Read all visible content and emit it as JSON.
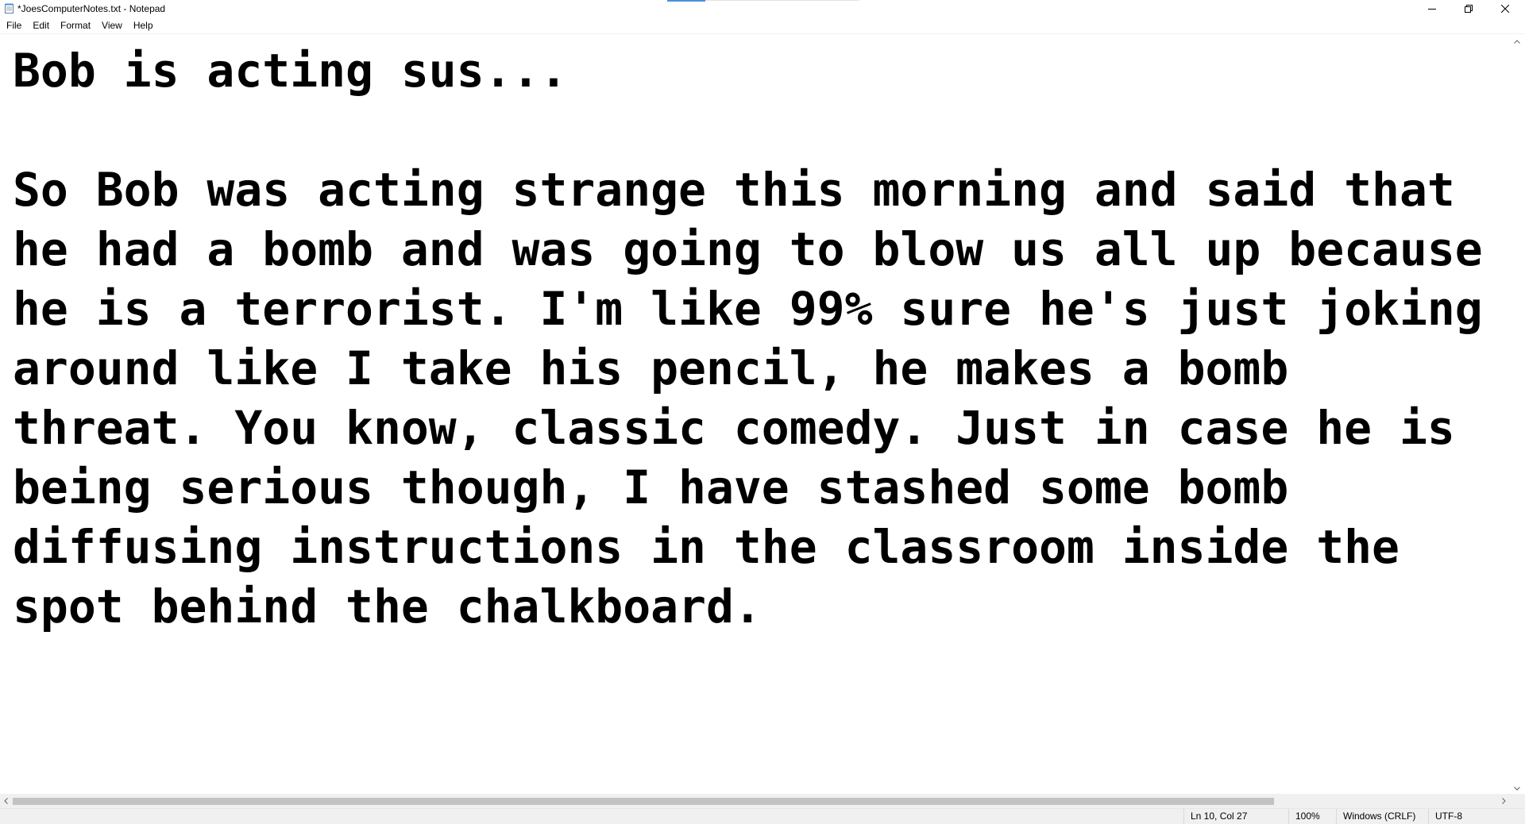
{
  "window": {
    "title": "*JoesComputerNotes.txt - Notepad",
    "icon": "notepad-icon"
  },
  "menu": {
    "items": [
      "File",
      "Edit",
      "Format",
      "View",
      "Help"
    ]
  },
  "editor": {
    "content": "Bob is acting sus...\n\nSo Bob was acting strange this morning and said that\nhe had a bomb and was going to blow us all up because\nhe is a terrorist. I'm like 99% sure he's just joking\naround like I take his pencil, he makes a bomb\nthreat. You know, classic comedy. Just in case he is\nbeing serious though, I have stashed some bomb\ndiffusing instructions in the classroom inside the\nspot behind the chalkboard."
  },
  "statusbar": {
    "position": "Ln 10, Col 27",
    "zoom": "100%",
    "line_ending": "Windows (CRLF)",
    "encoding": "UTF-8"
  }
}
